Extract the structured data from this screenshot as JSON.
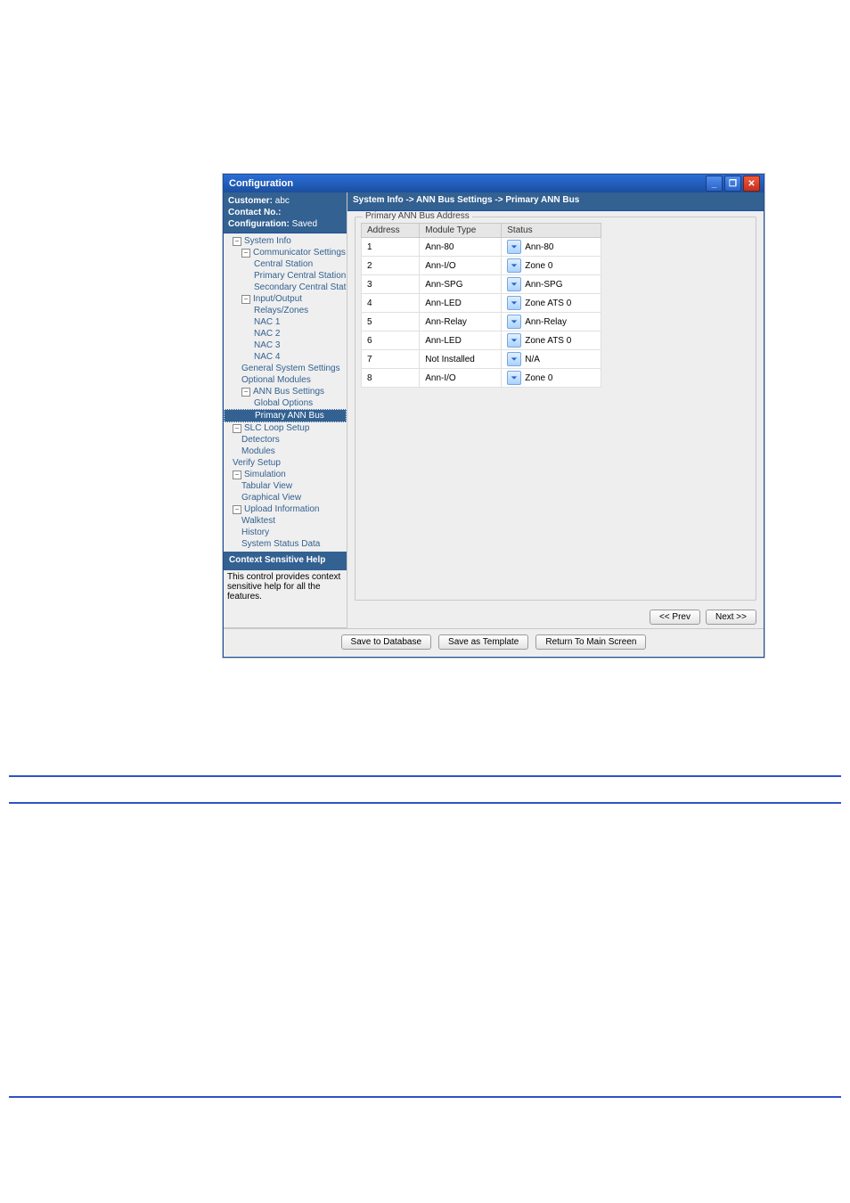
{
  "window": {
    "title": "Configuration"
  },
  "sidebar": {
    "customer_label": "Customer: ",
    "customer_value": "abc",
    "contact_label": "Contact No.:",
    "config_label": "Configuration: ",
    "config_value": "Saved",
    "help_title": "Context Sensitive Help",
    "help_text": "This control provides context sensitive help for all the features.",
    "tree": [
      {
        "l": 0,
        "label": "System Info",
        "exp": "-"
      },
      {
        "l": 1,
        "label": "Communicator Settings",
        "exp": "-"
      },
      {
        "l": 2,
        "label": "Central Station"
      },
      {
        "l": 2,
        "label": "Primary Central Station"
      },
      {
        "l": 2,
        "label": "Secondary Central Station"
      },
      {
        "l": 1,
        "label": "Input/Output",
        "exp": "-"
      },
      {
        "l": 2,
        "label": "Relays/Zones"
      },
      {
        "l": 2,
        "label": "NAC 1"
      },
      {
        "l": 2,
        "label": "NAC 2"
      },
      {
        "l": 2,
        "label": "NAC 3"
      },
      {
        "l": 2,
        "label": "NAC 4"
      },
      {
        "l": 1,
        "label": "General System Settings"
      },
      {
        "l": 1,
        "label": "Optional Modules"
      },
      {
        "l": 1,
        "label": "ANN Bus Settings",
        "exp": "-"
      },
      {
        "l": 2,
        "label": "Global Options"
      },
      {
        "l": 2,
        "label": "Primary ANN Bus",
        "sel": true
      },
      {
        "l": 0,
        "label": "SLC Loop Setup",
        "exp": "-"
      },
      {
        "l": 1,
        "label": "Detectors"
      },
      {
        "l": 1,
        "label": "Modules"
      },
      {
        "l": 0,
        "label": "Verify Setup"
      },
      {
        "l": 0,
        "label": "Simulation",
        "exp": "-"
      },
      {
        "l": 1,
        "label": "Tabular View"
      },
      {
        "l": 1,
        "label": "Graphical View"
      },
      {
        "l": 0,
        "label": "Upload Information",
        "exp": "-"
      },
      {
        "l": 1,
        "label": "Walktest"
      },
      {
        "l": 1,
        "label": "History"
      },
      {
        "l": 1,
        "label": "System Status Data"
      }
    ]
  },
  "content": {
    "breadcrumb": "System Info -> ANN Bus Settings -> Primary ANN Bus",
    "group_title": "Primary ANN Bus Address",
    "columns": [
      "Address",
      "Module Type",
      "Status"
    ],
    "rows": [
      {
        "addr": "1",
        "type": "Ann-80",
        "status": "Ann-80"
      },
      {
        "addr": "2",
        "type": "Ann-I/O",
        "status": "Zone 0"
      },
      {
        "addr": "3",
        "type": "Ann-SPG",
        "status": "Ann-SPG"
      },
      {
        "addr": "4",
        "type": "Ann-LED",
        "status": "Zone ATS 0"
      },
      {
        "addr": "5",
        "type": "Ann-Relay",
        "status": "Ann-Relay"
      },
      {
        "addr": "6",
        "type": "Ann-LED",
        "status": "Zone ATS 0"
      },
      {
        "addr": "7",
        "type": "Not Installed",
        "status": "N/A"
      },
      {
        "addr": "8",
        "type": "Ann-I/O",
        "status": "Zone 0"
      }
    ],
    "prev": "<< Prev",
    "next": "Next >>"
  },
  "footer": {
    "save_db": "Save to Database",
    "save_tpl": "Save as Template",
    "return_main": "Return To Main Screen"
  }
}
